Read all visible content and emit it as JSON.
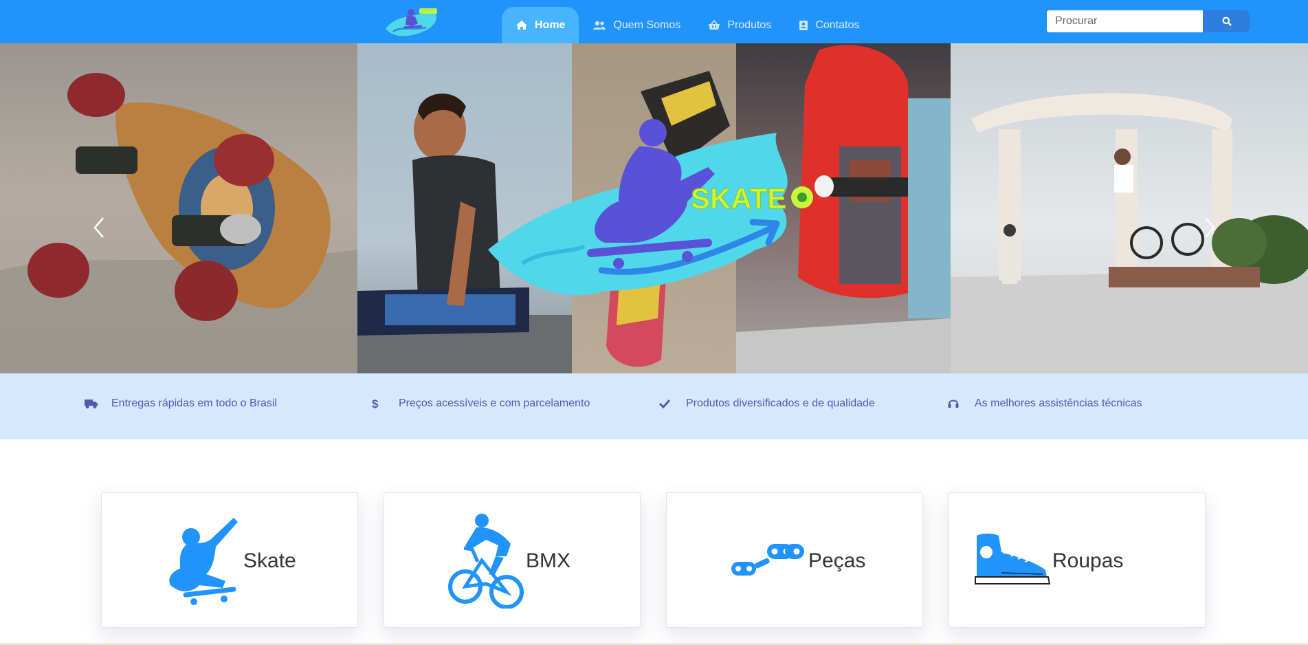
{
  "brand": {
    "logo_text": "SKATE ON",
    "logo_icon": "skater-splash-logo"
  },
  "nav": {
    "items": [
      {
        "label": "Home",
        "icon": "home-icon",
        "active": true
      },
      {
        "label": "Quem Somos",
        "icon": "users-icon",
        "active": false
      },
      {
        "label": "Produtos",
        "icon": "basket-icon",
        "active": false
      },
      {
        "label": "Contatos",
        "icon": "contact-card-icon",
        "active": false
      }
    ]
  },
  "search": {
    "placeholder": "Procurar",
    "value": "",
    "button_icon": "search-icon"
  },
  "hero": {
    "overlay_logo_text": "SKATE ON",
    "panels": [
      "skateboard-wheels-photo",
      "skater-holding-board-photo",
      "skateboard-wall-photo",
      "red-skateboard-photo",
      "bmx-park-photo"
    ],
    "prev_icon": "chevron-left-icon",
    "next_icon": "chevron-right-icon"
  },
  "features": [
    {
      "icon": "truck-icon",
      "text": "Entregas rápidas em todo o Brasil"
    },
    {
      "icon": "dollar-icon",
      "text": "Preços acessíveis e com parcelamento"
    },
    {
      "icon": "check-icon",
      "text": "Produtos diversificados e de qualidade"
    },
    {
      "icon": "headset-icon",
      "text": "As melhores assistências técnicas"
    }
  ],
  "categories": [
    {
      "label": "Skate",
      "icon": "skater-icon"
    },
    {
      "label": "BMX",
      "icon": "bmx-rider-icon"
    },
    {
      "label": "Peças",
      "icon": "bike-chain-icon"
    },
    {
      "label": "Roupas",
      "icon": "sneaker-icon"
    }
  ],
  "colors": {
    "navbar": "#2194fb",
    "nav_active": "#49b4fe",
    "search_button": "#2e7ee0",
    "features_band": "#d4e8fe",
    "feature_text": "#5159b4",
    "category_icon": "#2194fb",
    "logo_cyan": "#4fd8ea",
    "logo_purple": "#5a52d6",
    "logo_lime": "#c9f53a"
  }
}
